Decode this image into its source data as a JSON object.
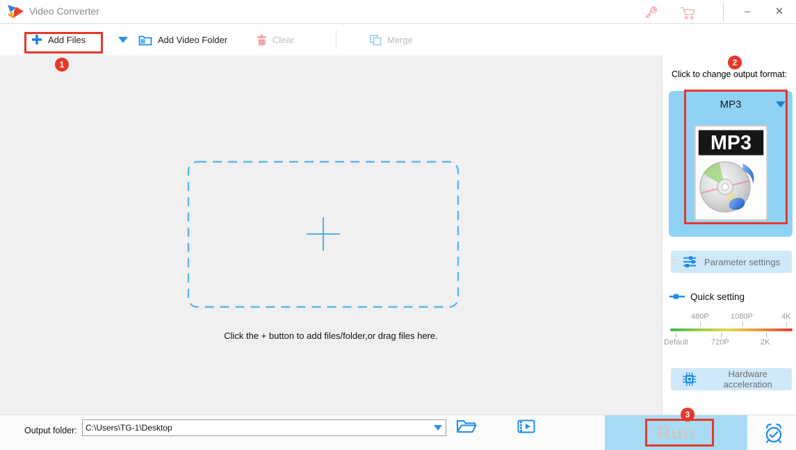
{
  "window": {
    "title": "Video Converter",
    "minimize_glyph": "–",
    "close_glyph": "✕"
  },
  "toolbar": {
    "add_files_label": "Add Files",
    "add_video_folder_label": "Add Video Folder",
    "clear_label": "Clear",
    "merge_label": "Merge"
  },
  "annotations": {
    "step1": "1",
    "step2": "2",
    "step3": "3"
  },
  "dropzone": {
    "hint": "Click the + button to add files/folder,or drag files here."
  },
  "format_panel": {
    "header": "Click to change output format:",
    "selected_format": "MP3",
    "format_icon_label": "MP3",
    "parameter_settings_label": "Parameter settings",
    "quick_setting_label": "Quick setting",
    "slider_labels_top": [
      "480P",
      "1080P",
      "4K"
    ],
    "slider_labels_bottom": [
      "Default",
      "720P",
      "2K"
    ],
    "hardware_acceleration_label": "Hardware acceleration"
  },
  "bottom_bar": {
    "output_folder_label": "Output folder:",
    "output_path": "C:\\Users\\TG-1\\Desktop",
    "run_label": "Run"
  },
  "icons": {
    "titlebar": [
      "key-icon",
      "cart-icon"
    ],
    "toolbar": [
      "plus-icon",
      "chevron-down-icon",
      "video-folder-icon",
      "trash-icon",
      "merge-icon"
    ],
    "panel": [
      "sliders-icon",
      "quick-slider-icon",
      "cpu-chip-icon"
    ],
    "bottom": [
      "folder-open-icon",
      "film-clip-icon",
      "alarm-clock-icon"
    ]
  },
  "colors": {
    "accent_blue": "#1b8ceb",
    "light_blue_button": "#cfe9fa",
    "format_card_blue": "#8fd2f3",
    "annotation_red": "#e5382b",
    "run_button_bg": "#a9dbf4",
    "disabled_text": "#bdbdbd",
    "slider_gradient": [
      "#3cb94d",
      "#e3d44a",
      "#e89a3c",
      "#df3b2d"
    ]
  }
}
